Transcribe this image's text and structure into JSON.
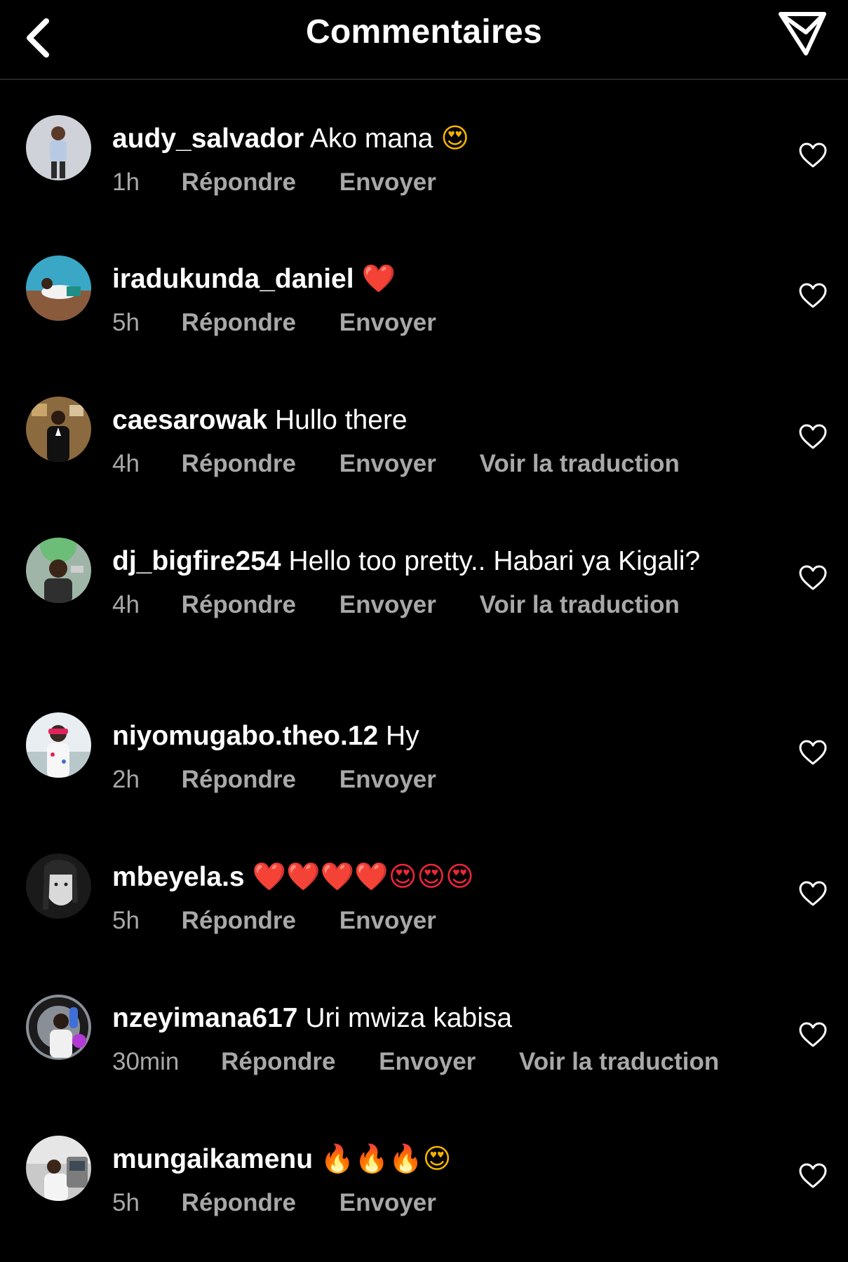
{
  "header": {
    "title": "Commentaires",
    "back_icon": "chevron-left-icon",
    "send_icon": "paper-plane-icon"
  },
  "colors": {
    "background": "#000000",
    "text": "#ffffff",
    "meta": "#a8a8a8",
    "heart_emoji": "#f0263a"
  },
  "comments": [
    {
      "username": "audy_salvador",
      "text": "Ako mana",
      "emoji": "😍",
      "time": "1h",
      "reply": "Répondre",
      "send": "Envoyer",
      "translate": ""
    },
    {
      "username": "iradukunda_daniel",
      "text": "",
      "emoji": "❤️",
      "time": "5h",
      "reply": "Répondre",
      "send": "Envoyer",
      "translate": ""
    },
    {
      "username": "caesarowak",
      "text": "Hullo there",
      "emoji": "",
      "time": "4h",
      "reply": "Répondre",
      "send": "Envoyer",
      "translate": "Voir la traduction"
    },
    {
      "username": "dj_bigfire254",
      "text": "Hello too pretty.. Habari ya Kigali?",
      "emoji": "",
      "time": "4h",
      "reply": "Répondre",
      "send": "Envoyer",
      "translate": "Voir la traduction"
    },
    {
      "username": "niyomugabo.theo.12",
      "text": "Hy",
      "emoji": "",
      "time": "2h",
      "reply": "Répondre",
      "send": "Envoyer",
      "translate": ""
    },
    {
      "username": "mbeyela.s",
      "text": "",
      "emoji": "❤️❤️❤️❤️😍😍😍",
      "time": "5h",
      "reply": "Répondre",
      "send": "Envoyer",
      "translate": ""
    },
    {
      "username": "nzeyimana617",
      "text": "Uri mwiza kabisa",
      "emoji": "",
      "time": "30min",
      "reply": "Répondre",
      "send": "Envoyer",
      "translate": "Voir la traduction"
    },
    {
      "username": "mungaikamenu",
      "text": "",
      "emoji": "🔥🔥🔥😍",
      "time": "5h",
      "reply": "Répondre",
      "send": "Envoyer",
      "translate": ""
    }
  ]
}
